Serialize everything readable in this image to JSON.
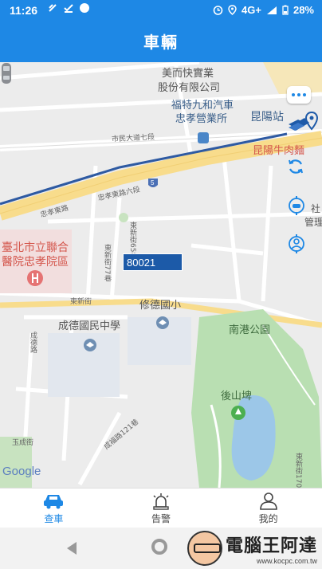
{
  "status_bar": {
    "time": "11:26",
    "network": "4G+",
    "battery": "28%"
  },
  "app_bar": {
    "title": "車輛"
  },
  "map": {
    "labels": {
      "poi_meierfu": "美而快實業",
      "poi_meierfu2": "股份有限公司",
      "poi_ford": "福特九和汽車",
      "poi_ford2": "忠孝營業所",
      "road_shimin": "市民大道七段",
      "road_zhongxiao6": "忠孝東路六段",
      "road_zhongxiao": "忠孝東路",
      "kunyang": "昆陽站",
      "kunyang_beef": "昆陽牛肉麵",
      "hospital1": "臺北市立聯合",
      "hospital2": "醫院忠孝院區",
      "xiude": "修德國小",
      "chengde": "成德國民中學",
      "nangang_park": "南港公園",
      "houshanpi": "後山埤",
      "dongxin_st": "東新街",
      "dongxin_65": "東新街65巷",
      "dongxin_77": "東新街77巷",
      "chengde_rd": "成德路",
      "chengde_121": "成福路121巷",
      "yucheng": "玉成街",
      "dongxin_170": "東新街170",
      "she_partial": "社",
      "guan_partial": "管理",
      "google": "Google"
    },
    "vehicle": {
      "plate": "80021"
    }
  },
  "tabs": [
    {
      "label": "查車",
      "icon": "car-icon",
      "active": true
    },
    {
      "label": "告警",
      "icon": "alarm-icon",
      "active": false
    },
    {
      "label": "我的",
      "icon": "person-icon",
      "active": false
    }
  ],
  "watermark": {
    "title": "電腦王阿達",
    "url": "www.kocpc.com.tw"
  },
  "colors": {
    "primary": "#1e88e5",
    "vehicle_tag": "#1c5aa8",
    "park_green": "#b9dfb2",
    "highway_yellow": "#f8dc8c"
  }
}
